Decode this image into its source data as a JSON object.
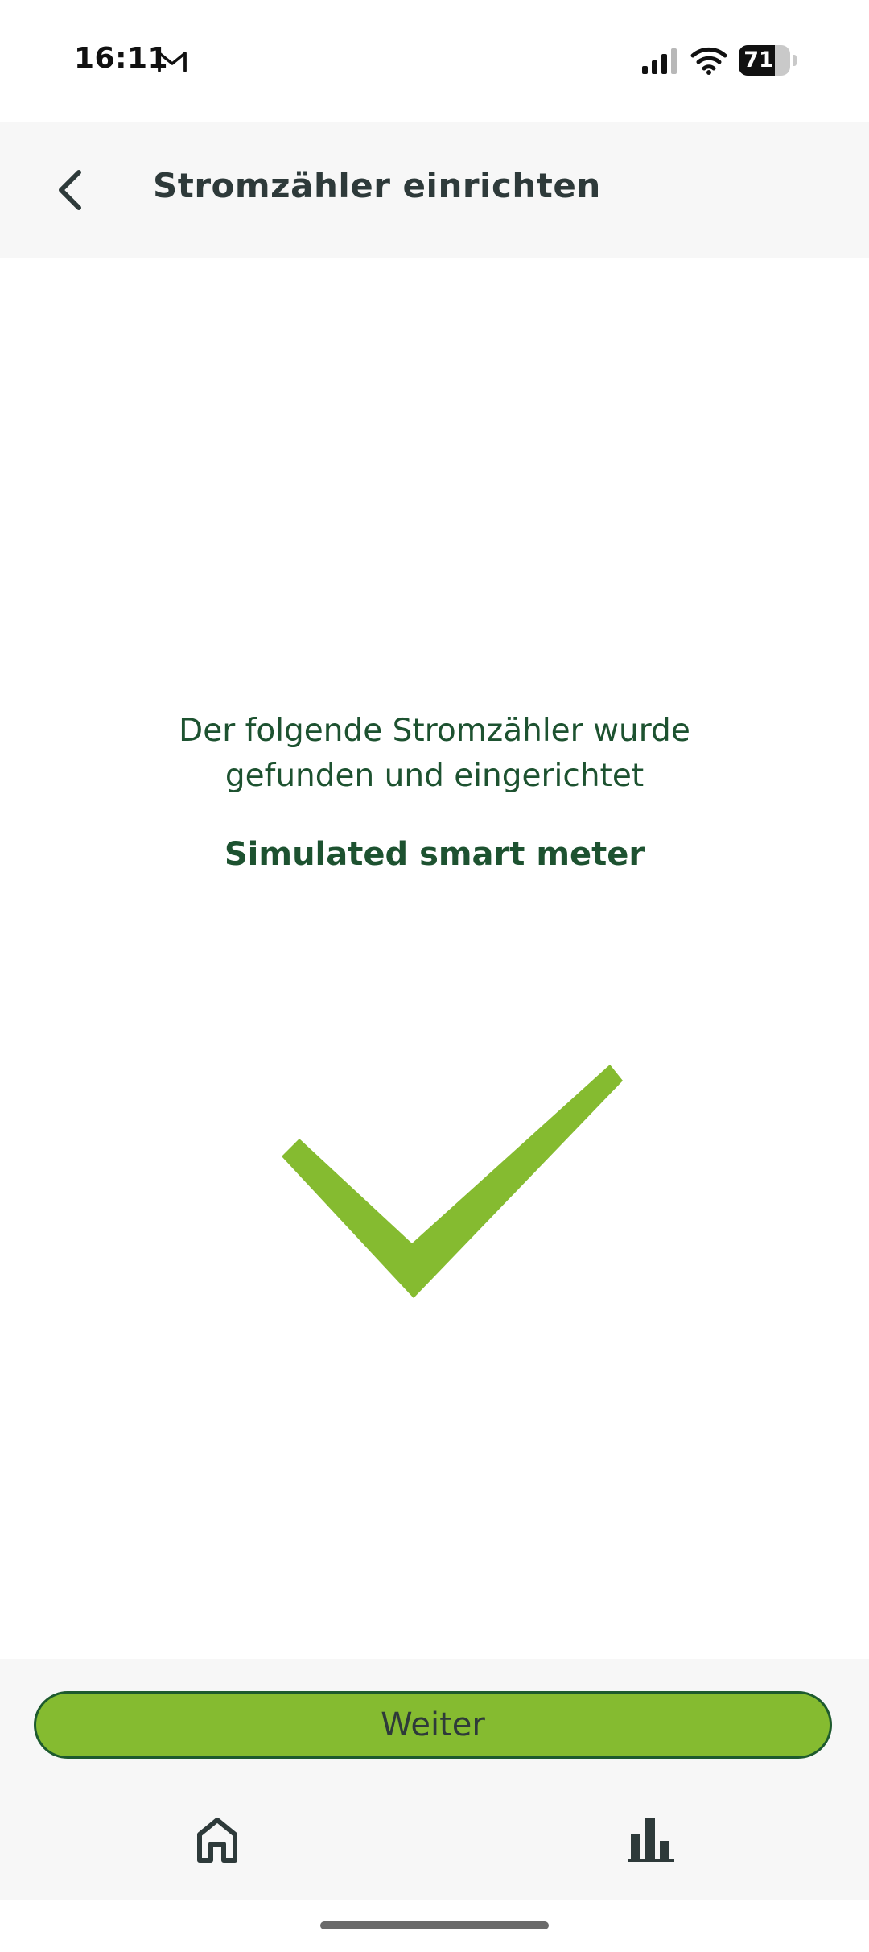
{
  "status_bar": {
    "time": "16:11",
    "notification_icon": "gmail-icon",
    "signal_icon": "cellular-signal-icon",
    "wifi_icon": "wifi-icon",
    "battery_percent": "71",
    "battery_level": 0.71
  },
  "header": {
    "back_icon": "chevron-left-icon",
    "title": "Stromzähler einrichten"
  },
  "main": {
    "message": "Der folgende Stromzähler wurde gefunden und eingerichtet",
    "device_name": "Simulated smart meter",
    "success_icon": "checkmark-icon"
  },
  "footer": {
    "continue_label": "Weiter",
    "tabs": [
      {
        "icon": "home-icon"
      },
      {
        "icon": "bar-chart-icon"
      }
    ]
  },
  "colors": {
    "accent_green": "#85bb30",
    "dark_green": "#1d5230",
    "header_bg": "#f7f7f7",
    "title_text": "#2e3a3a"
  }
}
